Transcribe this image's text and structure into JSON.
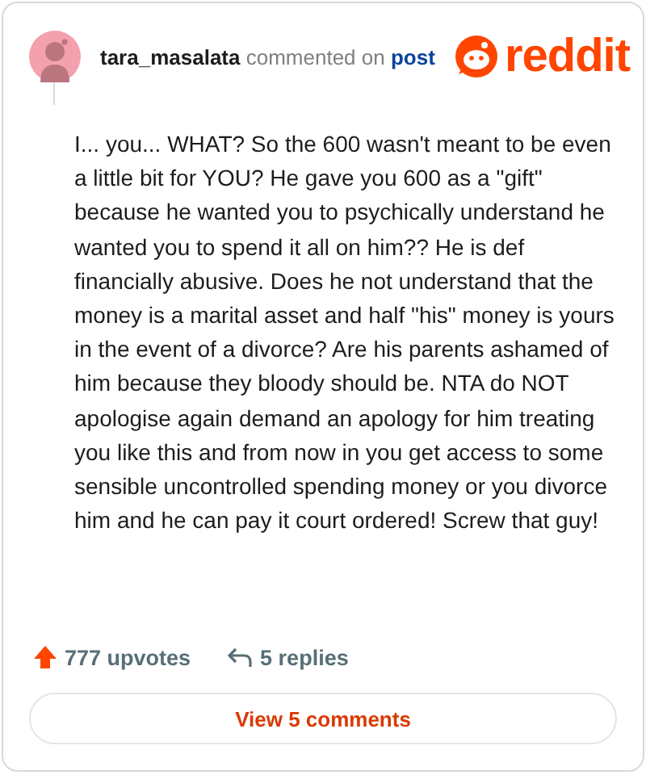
{
  "header": {
    "username": "tara_masalata",
    "action": "commented on",
    "link": "post",
    "logo": "reddit"
  },
  "comment": {
    "body": "I... you... WHAT? So the 600 wasn't meant to be even a little bit for YOU? He gave you 600 as a \"gift\" because he wanted you to psychically understand he wanted you to spend it all on him?? He is def financially abusive. Does he not understand that the money is a marital asset and half \"his\" money is yours in the event of a divorce? Are his parents ashamed of him because they bloody should be. NTA do NOT apologise again demand an apology for him treating you like this and from now in you get access to some sensible uncontrolled spending money or you divorce him and he can pay it court ordered! Screw that guy!"
  },
  "footer": {
    "upvotes": "777 upvotes",
    "replies": "5 replies"
  },
  "button": {
    "label": "View 5 comments"
  }
}
